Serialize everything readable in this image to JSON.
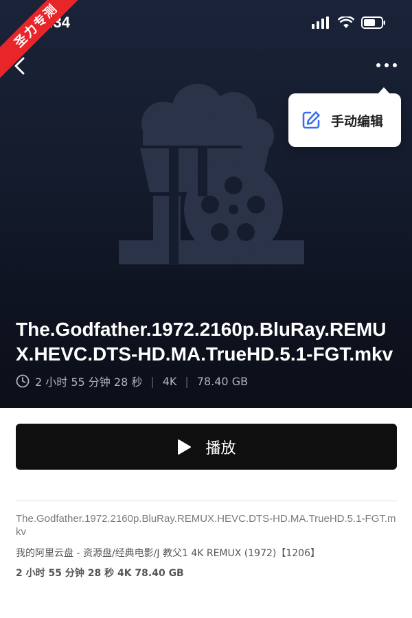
{
  "watermark": "圣力专测",
  "status_bar": {
    "time": "9:34"
  },
  "popover": {
    "edit_label": "手动编辑"
  },
  "movie": {
    "title": "The.Godfather.1972.2160p.BluRay.REMUX.HEVC.DTS-HD.MA.TrueHD.5.1-FGT.mkv",
    "duration": "2 小时 55 分钟 28 秒",
    "quality": "4K",
    "size": "78.40 GB"
  },
  "play_button": {
    "label": "播放"
  },
  "details": {
    "file_name": "The.Godfather.1972.2160p.BluRay.REMUX.HEVC.DTS-HD.MA.TrueHD.5.1-FGT.mkv",
    "path": "我的阿里云盘 - 资源盘/经典电影/J 教父1 4K REMUX (1972)【1206】",
    "summary": "2 小时 55 分钟 28 秒 4K 78.40 GB"
  },
  "colors": {
    "hero_top": "#1a2338",
    "hero_bottom": "#0b0f19",
    "accent": "#3b6cf6",
    "button_bg": "#0f0f10",
    "watermark_bg": "#e8262a"
  },
  "icons": [
    "back-chevron-icon",
    "more-dots-icon",
    "edit-icon",
    "popcorn-film-reel-icon",
    "clock-icon",
    "play-icon",
    "signal-icon",
    "wifi-icon",
    "battery-icon"
  ]
}
